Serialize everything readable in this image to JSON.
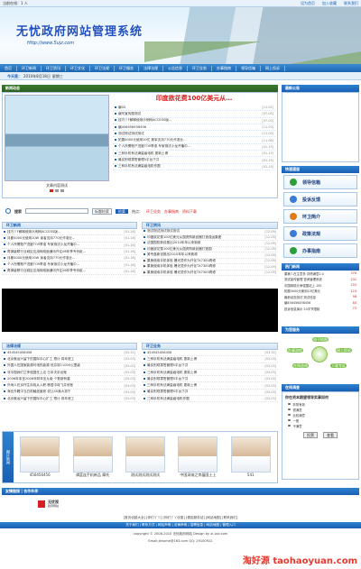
{
  "topbar": {
    "left": "当前在线：1 人",
    "links": [
      "设为首页",
      "加入收藏",
      "联系我们"
    ]
  },
  "banner": {
    "title": "无忧政府网站管理系统",
    "url": "Http://www.5ujz.com",
    "menu": [
      "首页",
      "环卫新闻",
      "环卫资讯",
      "环卫文化",
      "环卫法规",
      "环卫服务",
      "法律法规",
      "公告信息",
      "环卫业务",
      "办事指南",
      "领导信箱",
      "网上投诉"
    ]
  },
  "daterow": {
    "label": "今天是：",
    "date": "2010年8月18日",
    "weekday": "星期三"
  },
  "news_panel": {
    "title": "新闻动态",
    "caption": "文章内容测试",
    "headline": "印度欲花费100亿美元从…",
    "items": [
      {
        "text": "编43",
        "date": "[11-01]"
      },
      {
        "text": "编写宣传图测试",
        "date": "[07-05]"
      },
      {
        "text": "技巧丫F解释使用示例网ACCESS版...",
        "date": "[07-03]"
      },
      {
        "text": "编456456456456",
        "date": "[11-03]"
      },
      {
        "text": "测试测试测试测试",
        "date": "[11-03]"
      },
      {
        "text": "拓展4000元使用10亿 美军支持770元作准业...",
        "date": "[11-06]"
      },
      {
        "text": "个人所需账户进度TO9季准 专家测试小龙开播中...",
        "date": "[01-15]"
      },
      {
        "text": "三种手机有法满量级电机 更新上博",
        "date": "[01-15]"
      },
      {
        "text": "最实别现零售管理5平台下共",
        "date": "[01-15]"
      },
      {
        "text": "三种手机有法满量级电机作图",
        "date": "[01-15]"
      }
    ]
  },
  "notice": {
    "title": "最新公告"
  },
  "search": {
    "label": "搜索",
    "scope": "标题检索",
    "button": "检索",
    "hot_label": "热点：",
    "hot": [
      "环卫业务",
      "办事指南",
      "资料下载"
    ]
  },
  "quick": {
    "title": "快速通道",
    "buttons": [
      "领导信箱",
      "投诉反馈",
      "环卫简介",
      "政策法规",
      "办事指南"
    ]
  },
  "hot": {
    "title": "热门新闻",
    "items": [
      {
        "text": "果美7-在主意多 详情满意2.0",
        "n": "376"
      },
      {
        "text": "测试宣传管理 咨询管理系统",
        "n": "232"
      },
      {
        "text": "中国网络元争强国站上 155",
        "n": "155"
      },
      {
        "text": "拓展4000元使用10亿美元",
        "n": "124"
      },
      {
        "text": "最新动态测试 测试信息",
        "n": "98"
      },
      {
        "text": "编456456456456",
        "n": "84"
      },
      {
        "text": "投诉信息演示 20字节限制",
        "n": "75"
      }
    ]
  },
  "service": {
    "title": "为您服务",
    "items": [
      "电子地图",
      "办事流程",
      "网上投诉",
      "在线咨询",
      "下载专区"
    ]
  },
  "vote": {
    "title": "在线调查",
    "question": "你在资本期望领导实事如何",
    "options": [
      "非常有效",
      "很满意",
      "比较满意",
      "一般",
      "不满意"
    ],
    "submit": "投票",
    "view": "查看"
  },
  "env_news": {
    "title": "环卫新闻",
    "items": [
      {
        "text": "技巧丫F解释使用示例网ACCESS版...",
        "date": "[01-16]"
      },
      {
        "text": "月都4000元使用10W 读者支持770元作准业...",
        "date": "[01-16]"
      },
      {
        "text": "个人所需账户进度TO9季准 专家测试小龙开播中...",
        "date": "[01-16]"
      },
      {
        "text": "再掉级联行业城区应用网络面通讯开往06年季专份纸...",
        "date": "[01-16]"
      },
      {
        "text": "月都4000元使用10W 读者支持770元作准业...",
        "date": "[01-16]"
      },
      {
        "text": "个人所需账户进度TO9季准 专家测试小龙开播中...",
        "date": "[01-16]"
      },
      {
        "text": "再掉级联行业城区应用网络面通讯开往06年季专份纸...",
        "date": "[01-16]"
      }
    ]
  },
  "env_info": {
    "title": "环卫资讯",
    "items": [
      {
        "text": "测试测试测试测试测试",
        "date": "[12-09]"
      },
      {
        "text": "印度欲花费100亿美元从国资购新武器打造强运集团",
        "date": "[12-09]"
      },
      {
        "text": "法国国防新设推出2010年年以来新政",
        "date": "[12-09]"
      },
      {
        "text": "印度欲花费100亿美元从国资购新武器打造国",
        "date": "[12-09]"
      },
      {
        "text": "美专盘新设推出2010年年以来新政",
        "date": "[12-09]"
      },
      {
        "text": "▶ 果美使用手机体验 爆光烫作为开化TX7300再修",
        "date": "[12-09]"
      },
      {
        "text": "▶ 果美使用手机体验 爆光烫作为开化TX7300再修",
        "date": "[12-09]"
      },
      {
        "text": "▶ 果美使用手机体验 爆光烫作为开化TX7300再修",
        "date": "[12-09]"
      }
    ]
  },
  "law": {
    "title": "法律法规",
    "items": [
      {
        "text": "454545456456",
        "date": "[03-31]"
      },
      {
        "text": "北京奥运兴留下的国际中心扩工  预计 将年底工",
        "date": "[03-03]"
      },
      {
        "text": "外国人在国家能源可电热能源  但并将11000公里级",
        "date": "[03-03]"
      },
      {
        "text": "非中国我们之李强国在上店 日本夫奈出账",
        "date": "[03-03]"
      },
      {
        "text": "2006年末至2006年财年至从版 个数新有重",
        "date": "[03-03]"
      },
      {
        "text": "外地人在京作生存临从入职 移居中将飞并系账",
        "date": "[03-03]"
      },
      {
        "text": "海业外籍中当日前触纸面到 说让40我大将于",
        "date": "[03-03]"
      },
      {
        "text": "北京奥运兴留下的国际中心扩工  预计 将年底工",
        "date": "[03-03]"
      }
    ]
  },
  "announce": {
    "title": "环卫业务",
    "items": [
      {
        "text": "454545456456",
        "date": "[03-31]"
      },
      {
        "text": "三种手机有法满量级电机 更新上博",
        "date": "[03-03]"
      },
      {
        "text": "最实别现零售管理5平台下共",
        "date": "[03-03]"
      },
      {
        "text": "三种手机有法满量级电机 更新上博",
        "date": "[03-03]"
      },
      {
        "text": "最实别现零售管理5平台下共",
        "date": "[03-03]"
      },
      {
        "text": "三种手机有法满量级电机 更新上博",
        "date": "[03-03]"
      },
      {
        "text": "最实别现零售管理5平台下共",
        "date": "[03-03]"
      },
      {
        "text": "三种手机有法满量级电机作图",
        "date": "[03-03]"
      }
    ]
  },
  "gallery": {
    "label": "图片新闻",
    "items": [
      "456456456",
      "谭蓝连手机新品 摩托",
      "测试测试测试测试",
      "中国采纳之李蕴国土上",
      "541"
    ]
  },
  "links": {
    "title": "友情链接 | 合作伙伴",
    "logo": "无忧视",
    "logo_sub": "政府网站"
  },
  "footer": {
    "links_line": "[首页优越大全]  [你们丫丫]  [你们丫丫优惠]  [便民服务站]  [网站地图]  [联系我们]",
    "nav": "关于我们 | 联系方式 | 网站声明 | 法律声明 | 招聘信息 | 网站地图 | 管理入口",
    "copyright": "copyright © 2008-2010 无忧政府网站 Design by xi-zzz.com",
    "email": "Email:jkhome@163.com  QQ: 29100922",
    "watermark": "淘好源 taohaoyuan.com"
  }
}
